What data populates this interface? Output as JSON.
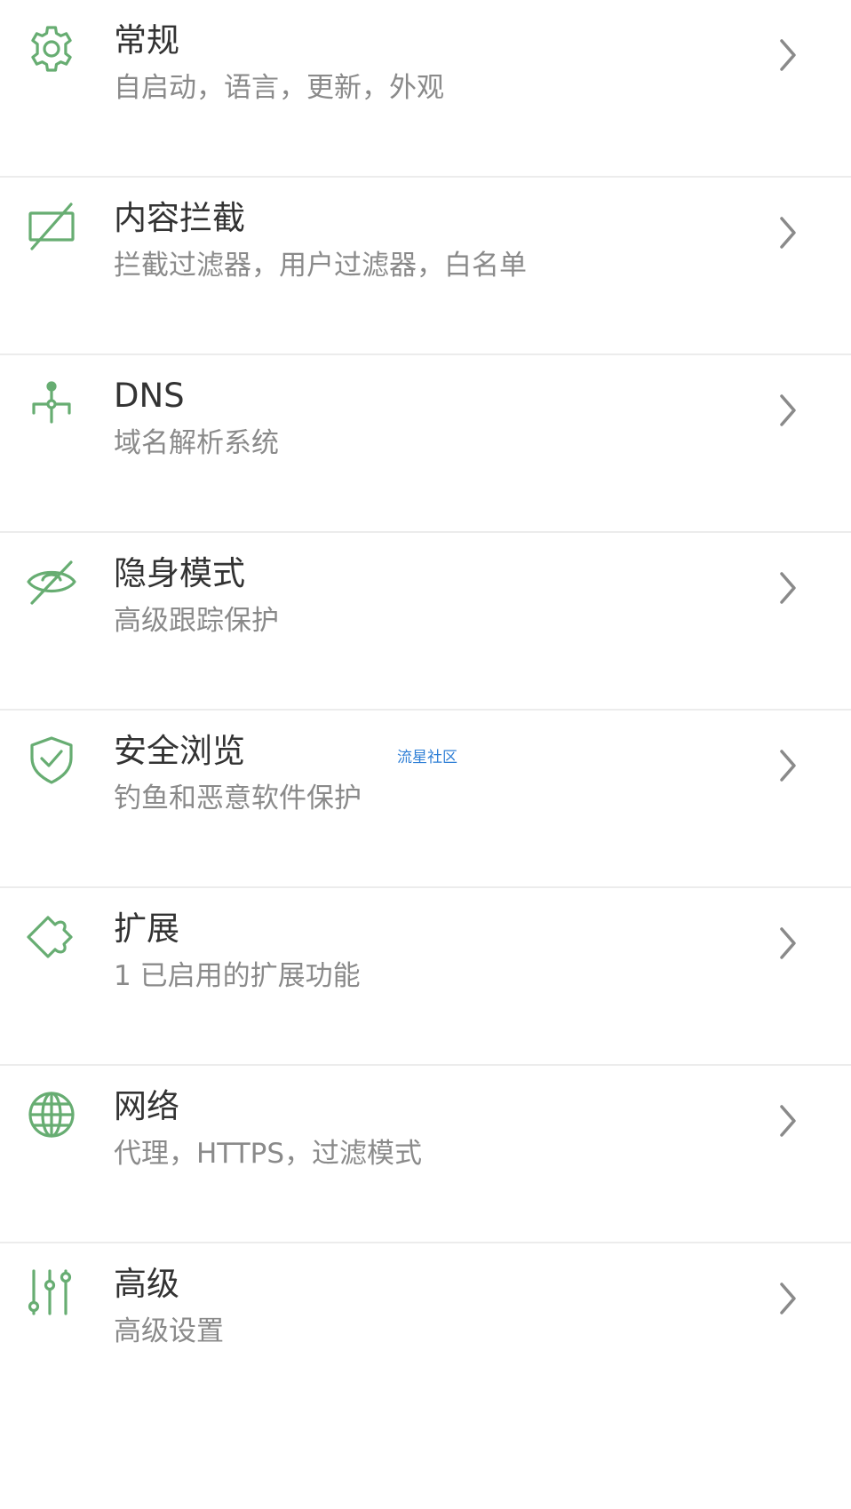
{
  "colors": {
    "accent": "#67ad72",
    "title": "#333333",
    "subtitle": "#8a8a8a",
    "divider": "#ececec",
    "chevron": "#8a8a8a",
    "watermark": "#2f7fd6"
  },
  "settings": {
    "items": [
      {
        "icon": "gear-icon",
        "title": "常规",
        "subtitle": "自启动，语言，更新，外观"
      },
      {
        "icon": "content-blocking-icon",
        "title": "内容拦截",
        "subtitle": "拦截过滤器，用户过滤器，白名单"
      },
      {
        "icon": "dns-icon",
        "title": "DNS",
        "subtitle": "域名解析系统"
      },
      {
        "icon": "eye-off-icon",
        "title": "隐身模式",
        "subtitle": "高级跟踪保护"
      },
      {
        "icon": "shield-check-icon",
        "title": "安全浏览",
        "subtitle": "钓鱼和恶意软件保护"
      },
      {
        "icon": "puzzle-icon",
        "title": "扩展",
        "subtitle": "1 已启用的扩展功能"
      },
      {
        "icon": "globe-icon",
        "title": "网络",
        "subtitle": "代理，HTTPS，过滤模式"
      },
      {
        "icon": "sliders-icon",
        "title": "高级",
        "subtitle": "高级设置"
      }
    ]
  },
  "watermark": "流星社区"
}
